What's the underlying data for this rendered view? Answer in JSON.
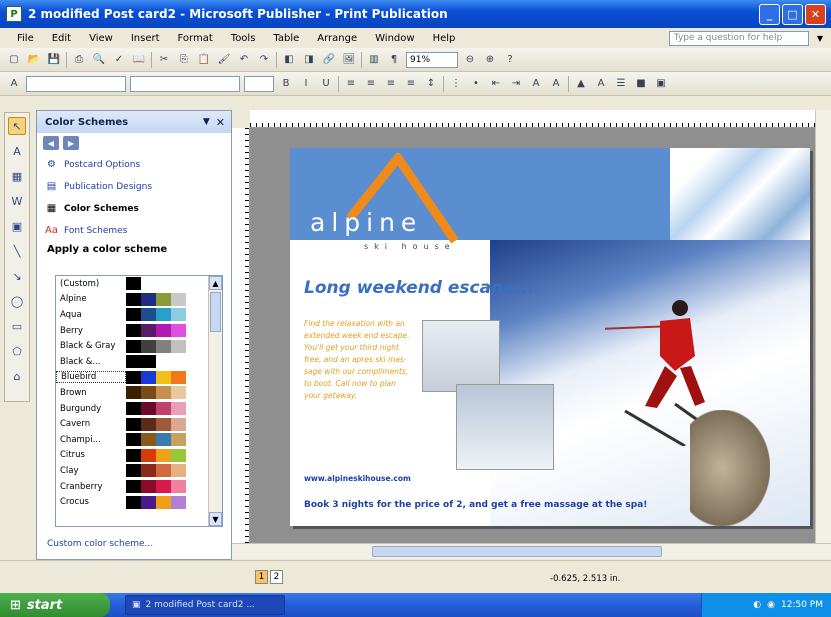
{
  "window": {
    "title": "2 modified Post card2 - Microsoft Publisher - Print Publication"
  },
  "menu": [
    "File",
    "Edit",
    "View",
    "Insert",
    "Format",
    "Tools",
    "Table",
    "Arrange",
    "Window",
    "Help"
  ],
  "help_placeholder": "Type a question for help",
  "toolbar": {
    "zoom": "91%"
  },
  "task_pane": {
    "title": "Color Schemes",
    "links": [
      {
        "label": "Postcard Options",
        "icon": "options-icon"
      },
      {
        "label": "Publication Designs",
        "icon": "designs-icon"
      },
      {
        "label": "Color Schemes",
        "icon": "color-schemes-icon",
        "active": true
      },
      {
        "label": "Font Schemes",
        "icon": "font-schemes-icon"
      }
    ],
    "apply_label": "Apply a color scheme",
    "schemes": [
      {
        "name": "(Custom)",
        "colors": [
          "#000000",
          "#ffffff",
          "#ffffff",
          "#ffffff",
          "#ffffff"
        ]
      },
      {
        "name": "Alpine",
        "colors": [
          "#000000",
          "#1c2f80",
          "#8a9b3a",
          "#c8c8c8",
          "#ffffff"
        ]
      },
      {
        "name": "Aqua",
        "colors": [
          "#000000",
          "#1a4f8a",
          "#2aa0c8",
          "#8ccbe0",
          "#ffffff"
        ]
      },
      {
        "name": "Berry",
        "colors": [
          "#000000",
          "#5a1a6a",
          "#b01ab0",
          "#e050e0",
          "#ffffff"
        ]
      },
      {
        "name": "Black & Gray",
        "colors": [
          "#000000",
          "#404040",
          "#808080",
          "#c0c0c0",
          "#ffffff"
        ]
      },
      {
        "name": "Black &...",
        "colors": [
          "#000000",
          "#000000",
          "#ffffff",
          "#ffffff",
          "#ffffff"
        ]
      },
      {
        "name": "Bluebird",
        "colors": [
          "#000000",
          "#1a3ad8",
          "#f0c018",
          "#f07818",
          "#ffffff"
        ]
      },
      {
        "name": "Brown",
        "colors": [
          "#3a2000",
          "#7a4a1a",
          "#c89050",
          "#e8c8a0",
          "#ffffff"
        ]
      },
      {
        "name": "Burgundy",
        "colors": [
          "#000000",
          "#6a0a2a",
          "#c04070",
          "#e8a0b8",
          "#ffffff"
        ]
      },
      {
        "name": "Cavern",
        "colors": [
          "#000000",
          "#5a2a1a",
          "#a05a3a",
          "#d8a890",
          "#ffffff"
        ]
      },
      {
        "name": "Champi...",
        "colors": [
          "#000000",
          "#8a5a1a",
          "#3a7ab0",
          "#c8a060",
          "#ffffff"
        ]
      },
      {
        "name": "Citrus",
        "colors": [
          "#000000",
          "#d83a0a",
          "#f0a018",
          "#98c838",
          "#ffffff"
        ]
      },
      {
        "name": "Clay",
        "colors": [
          "#000000",
          "#8a2a1a",
          "#d06a3a",
          "#e8b080",
          "#ffffff"
        ]
      },
      {
        "name": "Cranberry",
        "colors": [
          "#000000",
          "#8a0a2a",
          "#d81a4a",
          "#f080a0",
          "#ffffff"
        ]
      },
      {
        "name": "Crocus",
        "colors": [
          "#000000",
          "#4a1a8a",
          "#f0a018",
          "#b080d8",
          "#ffffff"
        ]
      }
    ],
    "custom_link": "Custom color scheme..."
  },
  "postcard": {
    "brand": "alpine",
    "brand_sub": "ski house",
    "headline": "Long weekend escape...",
    "body": "Find the relaxation with an extended week end escape. You'll get your third night free, and an apres ski mas- sage with our compliments, to boot. Call now to plan your getaway.",
    "website": "www.alpineskihouse.com",
    "promo": "Book 3 nights for the price of 2, and get a free massage at the spa!"
  },
  "status": {
    "pages": [
      "1",
      "2"
    ],
    "coords": "-0.625, 2.513 in."
  },
  "taskbar": {
    "start": "start",
    "task": "2 modified Post card2 ...",
    "time": "12:50 PM"
  },
  "colors": {
    "titlebar": "#0a4fd6",
    "accent_orange": "#f08a1a",
    "link_blue": "#1c3ea8"
  }
}
